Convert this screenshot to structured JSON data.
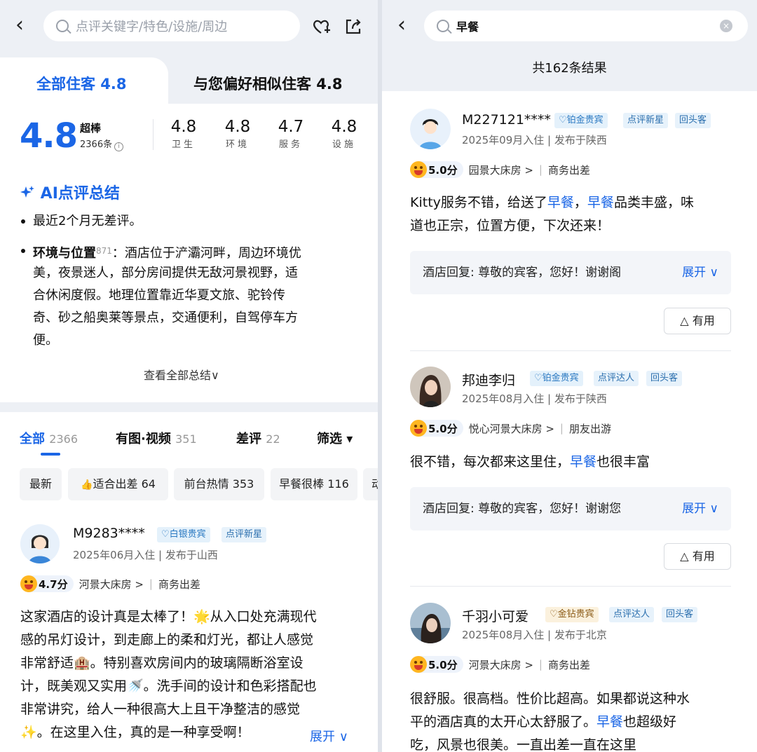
{
  "left": {
    "search": {
      "placeholder": "点评关键字/特色/设施/周边"
    },
    "tabs": {
      "all": "全部住客 4.8",
      "similar": "与您偏好相似住客 4.8"
    },
    "score": {
      "value": "4.8",
      "level": "超棒",
      "count": "2366条",
      "info_glyph": "i",
      "sub": [
        {
          "value": "4.8",
          "label": "卫生"
        },
        {
          "value": "4.8",
          "label": "环境"
        },
        {
          "value": "4.7",
          "label": "服务"
        },
        {
          "value": "4.8",
          "label": "设施"
        }
      ]
    },
    "ai": {
      "title": "AI点评总结",
      "bullet1": "最近2个月无差评。",
      "bullet2_title": "环境与位置",
      "bullet2_count": "871",
      "bullet2_lines": [
        "：酒店位于浐灞河畔，周边环境优",
        "美，夜景迷人，部分房间提供无敌河景视野，适",
        "合休闲度假。地理位置靠近华夏文旅、驼铃传",
        "奇、砂之船奥莱等景点，交通便利，自驾停车方",
        "便。"
      ],
      "see_all": "查看全部总结∨"
    },
    "review_tabs": [
      {
        "label": "全部",
        "count": "2366"
      },
      {
        "label": "有图·视频",
        "count": "351"
      },
      {
        "label": "差评",
        "count": "22"
      }
    ],
    "filter": "筛选 ▾",
    "chips": [
      "最新",
      "适合出差 64",
      "前台热情 353",
      "早餐很棒 116",
      "动"
    ],
    "review": {
      "user": "M9283****",
      "vip": "白银贵宾",
      "tag": "点评新星",
      "meta": "2025年06月入住 | 发布于山西",
      "rating": "4.7分",
      "room": "河景大床房 >",
      "trip": "商务出差",
      "lines": [
        "这家酒店的设计真是太棒了！🌟从入口处充满现代",
        "感的吊灯设计，到走廊上的柔和灯光，都让人感觉",
        "非常舒适🏨。特别喜欢房间内的玻璃隔断浴室设",
        "计，既美观又实用🚿。洗手间的设计和色彩搭配也",
        "非常讲究，给人一种很高大上且干净整洁的感觉",
        "✨。在这里入住，真的是一种享受啊！"
      ],
      "expand": "展开 ∨"
    }
  },
  "right": {
    "search": {
      "value": "早餐"
    },
    "result_count": "共162条结果",
    "reviews": [
      {
        "user": "M227121****",
        "vip": "铂金贵宾",
        "tags": [
          "点评新星",
          "回头客"
        ],
        "meta": "2025年09月入住 | 发布于陕西",
        "rating": "5.0分",
        "room": "园景大床房 >",
        "trip": "商务出差",
        "line1_a": "Kitty服务不错，给送了",
        "line1_hl1": "早餐",
        "line1_b": "，",
        "line1_hl2": "早餐",
        "line1_c": "品类丰盛，味",
        "line2": "道也正宗，位置方便，下次还来！",
        "reply": "酒店回复: 尊敬的宾客，您好！谢谢阁",
        "expand": "展开 ∨",
        "useful": "△ 有用"
      },
      {
        "user": "邦迪李归",
        "vip": "铂金贵宾",
        "tags": [
          "点评达人",
          "回头客"
        ],
        "meta": "2025年08月入住 | 发布于陕西",
        "rating": "5.0分",
        "room": "悦心河景大床房 >",
        "trip": "朋友出游",
        "line1_a": "很不错，每次都来这里住，",
        "line1_hl": "早餐",
        "line1_b": "也很丰富",
        "reply": "酒店回复: 尊敬的宾客，您好！谢谢您",
        "expand": "展开 ∨",
        "useful": "△ 有用"
      },
      {
        "user": "千羽小可爱",
        "vip": "金钻贵宾",
        "tags": [
          "点评达人",
          "回头客"
        ],
        "meta": "2025年08月入住 | 发布于北京",
        "rating": "5.0分",
        "room": "河景大床房 >",
        "trip": "商务出差",
        "line1": "很舒服。很高档。性价比超高。如果都说这种水",
        "line2_a": "平的酒店真的太开心太舒服了。",
        "line2_hl": "早餐",
        "line2_b": "也超级好",
        "line3": "吃，风景也很美。一直出差一直在这里"
      }
    ]
  },
  "colors": {
    "accent": "#1b66e6",
    "rating_face": "#ffb620",
    "header_bg": "#edf0f5"
  }
}
